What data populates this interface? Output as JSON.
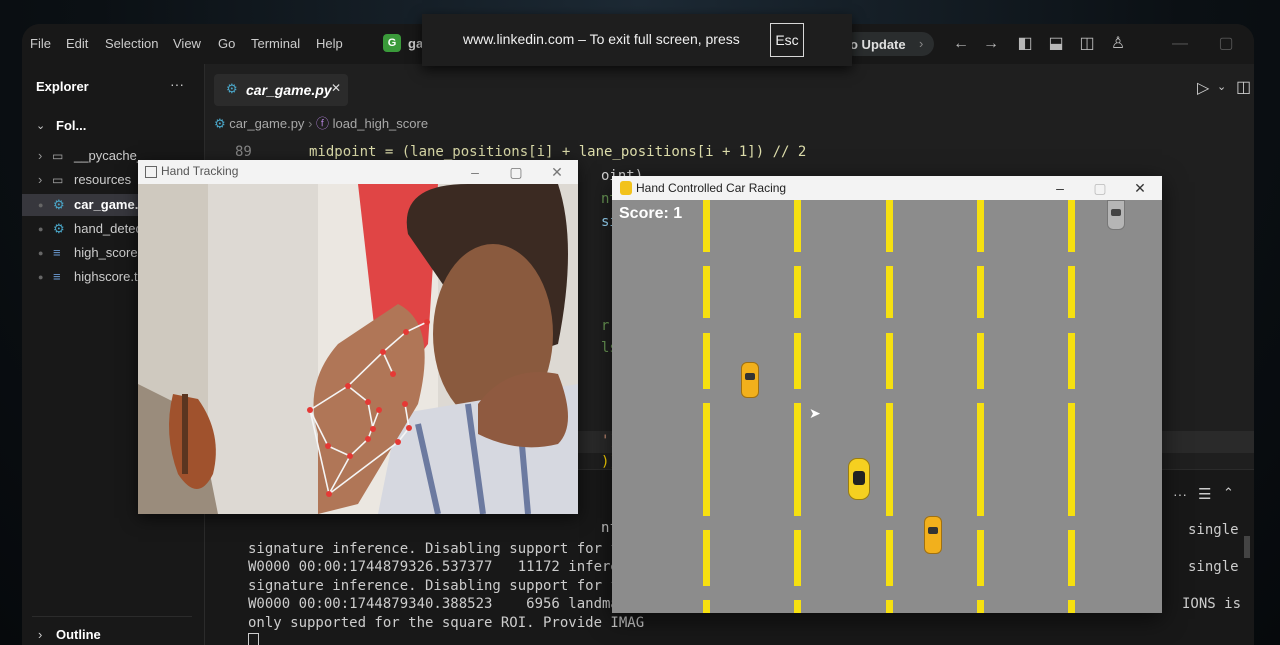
{
  "menubar": {
    "items": [
      "File",
      "Edit",
      "Selection",
      "View",
      "Go",
      "Terminal",
      "Help"
    ],
    "project_badge": "G",
    "project_text": "ga",
    "update_label": "o Update"
  },
  "fullscreen_banner": {
    "text": "www.linkedin.com – To exit full screen, press",
    "key": "Esc"
  },
  "sidebar": {
    "title": "Explorer",
    "more": "···",
    "folder": "Fol...",
    "items": [
      {
        "label": "__pycache_",
        "kind": "folder"
      },
      {
        "label": "resources",
        "kind": "folder"
      },
      {
        "label": "car_game.p",
        "kind": "python"
      },
      {
        "label": "hand_detec",
        "kind": "python"
      },
      {
        "label": "high_score",
        "kind": "text"
      },
      {
        "label": "highscore.t",
        "kind": "text"
      }
    ],
    "outline": "Outline"
  },
  "editor": {
    "tab_label": "car_game.py",
    "tab_close": "✕",
    "breadcrumb_file": "car_game.py",
    "breadcrumb_symbol": "load_high_score",
    "line_number": "89",
    "code_line": "midpoint = (lane_positions[i] + lane_positions[i + 1]) // 2",
    "fragments": [
      "oint)",
      "nt b",
      "sitio",
      "r ea",
      "ls fo",
      "') a",
      "))"
    ]
  },
  "terminal": {
    "lines": [
      "signature inference. Disabling support for feed",
      "W0000 00:00:1744879326.537377   11172 inference",
      "signature inference. Disabling support for feed",
      "W0000 00:00:1744879340.388523    6956 landmark_",
      "only supported for the square ROI. Provide IMAG"
    ],
    "line0_fragment": "nference",
    "right_fragments": [
      "single",
      "single",
      "IONS is"
    ]
  },
  "hand_window": {
    "title": "Hand Tracking"
  },
  "game_window": {
    "title": "Hand Controlled Car Racing",
    "score_label": "Score: 1"
  },
  "colors": {
    "accent_blue": "#3794ff",
    "lane_yellow": "#f6e010",
    "road_gray": "#8c8c8c",
    "landmark_red": "#e53935"
  }
}
